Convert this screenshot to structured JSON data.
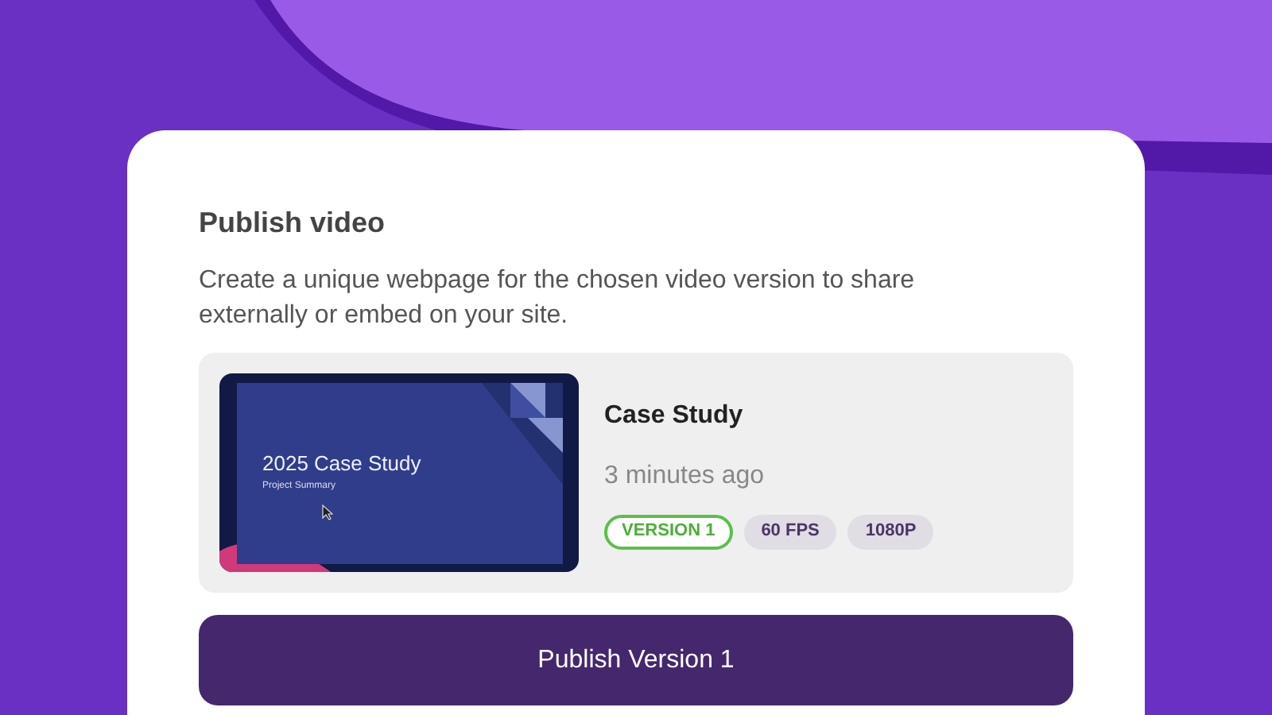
{
  "dialog": {
    "title": "Publish video",
    "description": "Create a unique webpage for the chosen video version to share externally or embed on your site."
  },
  "video": {
    "thumbnail": {
      "title": "2025 Case Study",
      "subtitle": "Project Summary"
    },
    "name": "Case Study",
    "time": "3 minutes ago",
    "tags": [
      {
        "label": "VERSION 1",
        "kind": "outline"
      },
      {
        "label": "60 FPS",
        "kind": "filled"
      },
      {
        "label": "1080P",
        "kind": "filled"
      }
    ]
  },
  "publish_button": "Publish Version 1"
}
